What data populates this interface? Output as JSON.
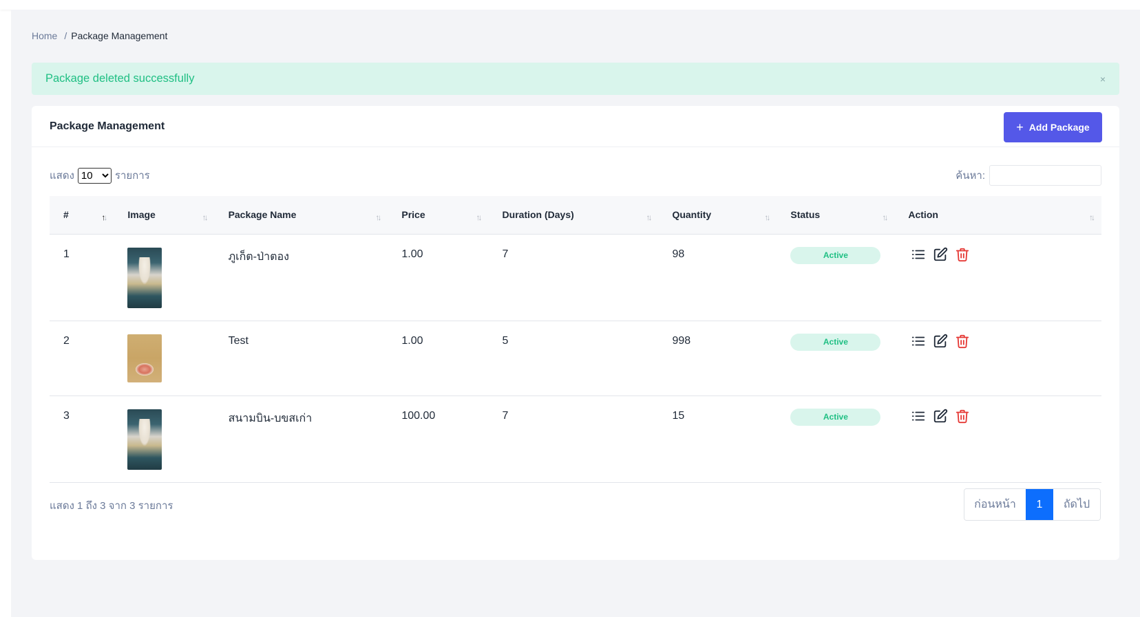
{
  "breadcrumb": {
    "home": "Home",
    "separator": "/",
    "current": "Package Management"
  },
  "alert": {
    "message": "Package deleted successfully",
    "close": "×"
  },
  "card": {
    "title": "Package Management",
    "add_button": "Add Package",
    "add_icon": "+"
  },
  "controls": {
    "show_prefix": "แสดง",
    "page_length": "10",
    "page_length_options": [
      "10"
    ],
    "show_suffix": "รายการ",
    "search_label": "ค้นหา:",
    "search_value": ""
  },
  "table": {
    "columns": [
      "#",
      "Image",
      "Package Name",
      "Price",
      "Duration (Days)",
      "Quantity",
      "Status",
      "Action"
    ],
    "rows": [
      {
        "no": "1",
        "name": "ภูเก็ต-ป่าตอง",
        "price": "1.00",
        "duration": "7",
        "quantity": "98",
        "status": "Active"
      },
      {
        "no": "2",
        "name": "Test",
        "price": "1.00",
        "duration": "5",
        "quantity": "998",
        "status": "Active"
      },
      {
        "no": "3",
        "name": "สนามบิน-บขสเก่า",
        "price": "100.00",
        "duration": "7",
        "quantity": "15",
        "status": "Active"
      }
    ]
  },
  "footer": {
    "info": "แสดง 1 ถึง 3 จาก 3 รายการ",
    "prev": "ก่อนหน้า",
    "current_page": "1",
    "next": "ถัดไป"
  },
  "colors": {
    "primary": "#5458e8",
    "success_text": "#1fbf83",
    "success_bg": "#d9f5ec",
    "danger": "#e53935",
    "pager_active": "#0d6efd"
  }
}
